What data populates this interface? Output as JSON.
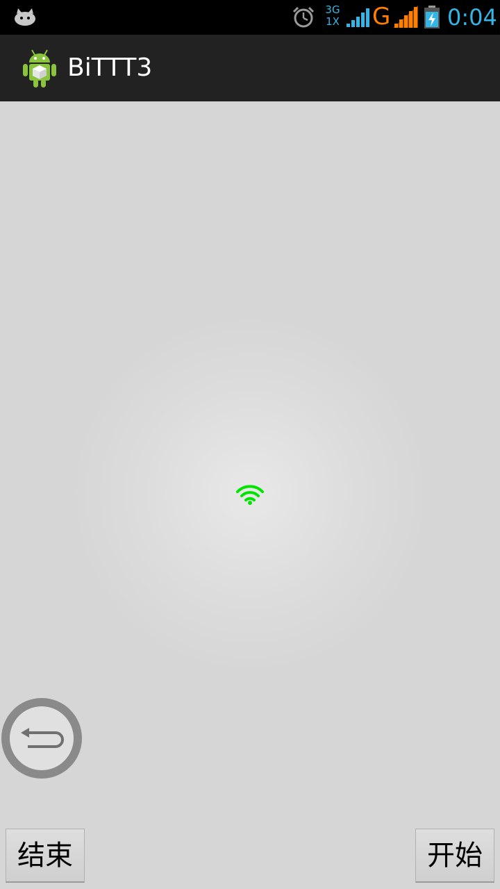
{
  "status_bar": {
    "network_line1": "3G",
    "network_line2": "1X",
    "carrier_g": "G",
    "time": "0:04",
    "icons": [
      "android-notification-icon",
      "alarm-icon",
      "signal-bars-blue-icon",
      "signal-bars-orange-icon",
      "battery-charging-icon"
    ]
  },
  "action_bar": {
    "title": "BiTTT3",
    "icon": "android-app-icon"
  },
  "content": {
    "center_icon": "wifi-icon",
    "center_icon_color": "#00e400",
    "floating_button_icon": "back-arrow-icon"
  },
  "buttons": {
    "stop_label": "结束",
    "start_label": "开始"
  },
  "colors": {
    "status_accent_blue": "#33b5e5",
    "status_accent_orange": "#ff7f00",
    "action_bar_bg": "#222222",
    "content_bg": "#d6d6d6"
  }
}
